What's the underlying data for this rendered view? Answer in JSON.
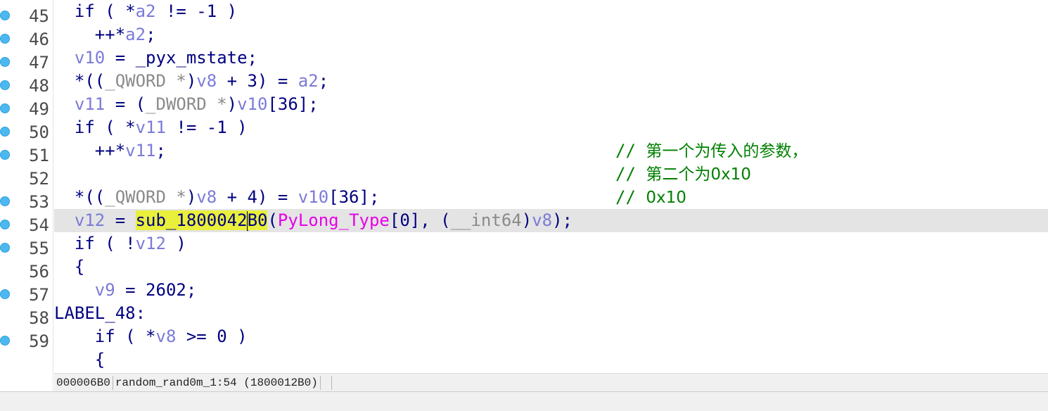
{
  "gutter": [
    {
      "num": "45",
      "bp": true
    },
    {
      "num": "46",
      "bp": true
    },
    {
      "num": "47",
      "bp": true
    },
    {
      "num": "48",
      "bp": true
    },
    {
      "num": "49",
      "bp": true
    },
    {
      "num": "50",
      "bp": true
    },
    {
      "num": "51",
      "bp": true
    },
    {
      "num": "52",
      "bp": false
    },
    {
      "num": "53",
      "bp": true
    },
    {
      "num": "54",
      "bp": true
    },
    {
      "num": "55",
      "bp": true
    },
    {
      "num": "56",
      "bp": false
    },
    {
      "num": "57",
      "bp": true
    },
    {
      "num": "58",
      "bp": false
    },
    {
      "num": "59",
      "bp": true
    },
    {
      "num": "",
      "bp": false
    }
  ],
  "code_lines": [
    [
      [
        "kw",
        "  if ( *"
      ],
      [
        "var",
        "a2"
      ],
      [
        "kw",
        " != -1 )"
      ]
    ],
    [
      [
        "kw",
        "    ++*"
      ],
      [
        "var",
        "a2"
      ],
      [
        "kw",
        ";"
      ]
    ],
    [
      [
        "var",
        "  v10"
      ],
      [
        "kw",
        " = _pyx_mstate;"
      ]
    ],
    [
      [
        "kw",
        "  *(("
      ],
      [
        "type",
        "_QWORD *"
      ],
      [
        "kw",
        ")"
      ],
      [
        "var",
        "v8"
      ],
      [
        "kw",
        " + 3) = "
      ],
      [
        "var",
        "a2"
      ],
      [
        "kw",
        ";"
      ]
    ],
    [
      [
        "var",
        "  v11"
      ],
      [
        "kw",
        " = ("
      ],
      [
        "type",
        "_DWORD *"
      ],
      [
        "kw",
        ")"
      ],
      [
        "var",
        "v10"
      ],
      [
        "kw",
        "[36];"
      ]
    ],
    [
      [
        "kw",
        "  if ( *"
      ],
      [
        "var",
        "v11"
      ],
      [
        "kw",
        " != -1 )"
      ]
    ],
    [
      [
        "kw",
        "    ++*"
      ],
      [
        "var",
        "v11"
      ],
      [
        "kw",
        ";"
      ]
    ],
    [],
    [
      [
        "kw",
        "  *(("
      ],
      [
        "type",
        "_QWORD *"
      ],
      [
        "kw",
        ")"
      ],
      [
        "var",
        "v8"
      ],
      [
        "kw",
        " + 4) = "
      ],
      [
        "var",
        "v10"
      ],
      [
        "kw",
        "[36];"
      ]
    ],
    [
      [
        "var",
        "  v12"
      ],
      [
        "kw",
        " = "
      ],
      [
        "hl",
        "sub_1800042"
      ],
      [
        "caret",
        ""
      ],
      [
        "hl",
        "B0"
      ],
      [
        "kw",
        "("
      ],
      [
        "global",
        "PyLong_Type"
      ],
      [
        "kw",
        "[0], ("
      ],
      [
        "type",
        "__int64"
      ],
      [
        "kw",
        ")"
      ],
      [
        "var",
        "v8"
      ],
      [
        "kw",
        ");"
      ]
    ],
    [
      [
        "kw",
        "  if ( !"
      ],
      [
        "var",
        "v12"
      ],
      [
        "kw",
        " )"
      ]
    ],
    [
      [
        "kw",
        "  {"
      ]
    ],
    [
      [
        "var",
        "    v9"
      ],
      [
        "kw",
        " = 2602;"
      ]
    ],
    [
      [
        "label",
        "LABEL_48:"
      ]
    ],
    [
      [
        "kw",
        "    if ( *"
      ],
      [
        "var",
        "v8"
      ],
      [
        "kw",
        " >= 0 )"
      ]
    ],
    [
      [
        "kw",
        "    {"
      ]
    ]
  ],
  "current_line_index": 9,
  "comments": [
    {
      "line_index": 6,
      "prefix": "// ",
      "text": "第一个为传入的参数，"
    },
    {
      "line_index": 7,
      "prefix": "// ",
      "text": "第二个为0x10"
    },
    {
      "line_index": 8,
      "prefix": "// ",
      "text": "0x10"
    }
  ],
  "statusbar": {
    "address": "000006B0",
    "location": "random_rand0m_1:54 (1800012B0)"
  },
  "colors": {
    "keyword": "#000080",
    "variable": "#7b7bd8",
    "type": "#8a8a8a",
    "global": "#e800e8",
    "comment": "#008000",
    "highlight": "#e9ef3a",
    "current_line": "#e4e4e4",
    "breakpoint": "#4db8f0"
  }
}
